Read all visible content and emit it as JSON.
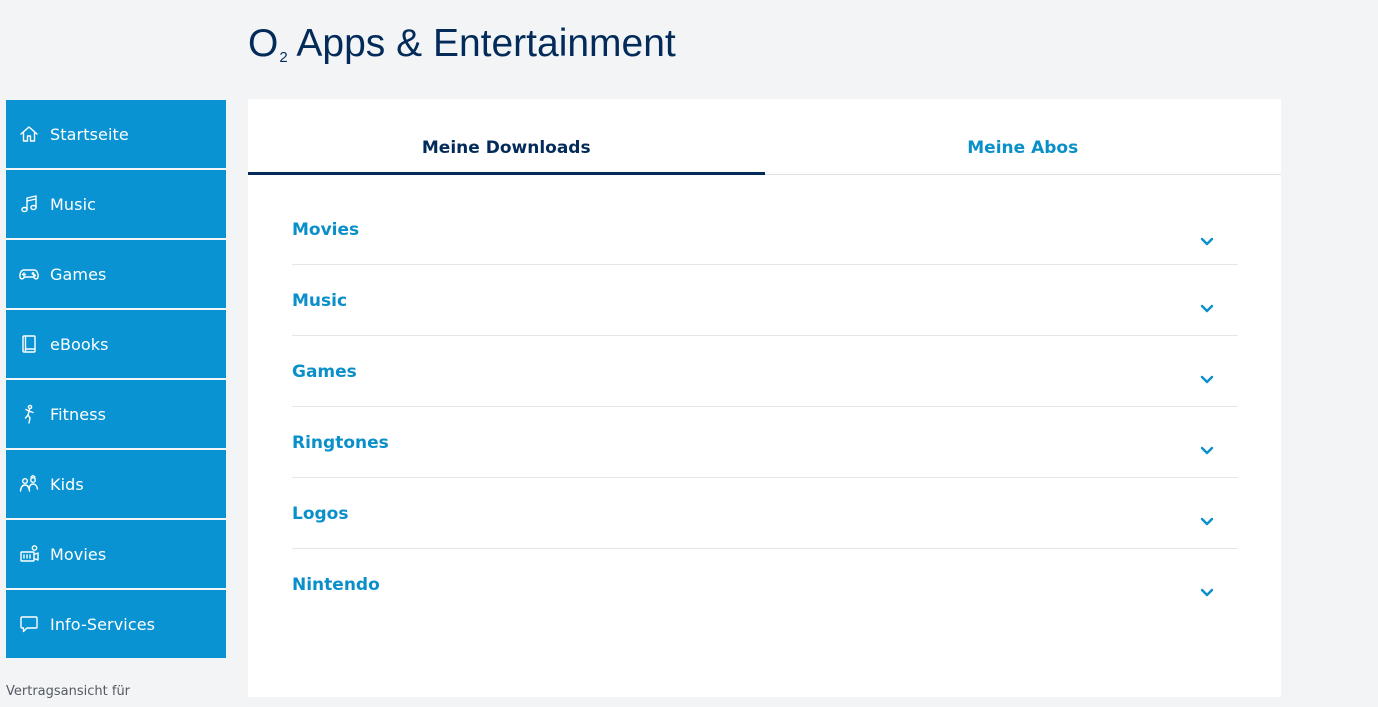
{
  "header": {
    "title_brand": "O",
    "title_brand_sub": "2",
    "title_rest": "Apps & Entertainment"
  },
  "sidebar": {
    "items": [
      {
        "label": "Startseite",
        "icon": "home-icon"
      },
      {
        "label": "Music",
        "icon": "music-note-icon"
      },
      {
        "label": "Games",
        "icon": "gamepad-icon"
      },
      {
        "label": "eBooks",
        "icon": "book-icon"
      },
      {
        "label": "Fitness",
        "icon": "running-person-icon"
      },
      {
        "label": "Kids",
        "icon": "kids-icon"
      },
      {
        "label": "Movies",
        "icon": "movie-camera-icon"
      },
      {
        "label": "Info-Services",
        "icon": "chat-bubble-icon"
      }
    ],
    "contract_view": "Vertragsansicht für"
  },
  "tabs": [
    {
      "label": "Meine Downloads",
      "active": true
    },
    {
      "label": "Meine Abos",
      "active": false
    }
  ],
  "downloads": {
    "categories": [
      {
        "label": "Movies"
      },
      {
        "label": "Music"
      },
      {
        "label": "Games"
      },
      {
        "label": "Ringtones"
      },
      {
        "label": "Logos"
      },
      {
        "label": "Nintendo"
      }
    ]
  },
  "colors": {
    "sidebar_bg": "#0a93d3",
    "accent": "#0a8fc9",
    "title": "#032b5a",
    "page_bg": "#f3f4f6"
  }
}
